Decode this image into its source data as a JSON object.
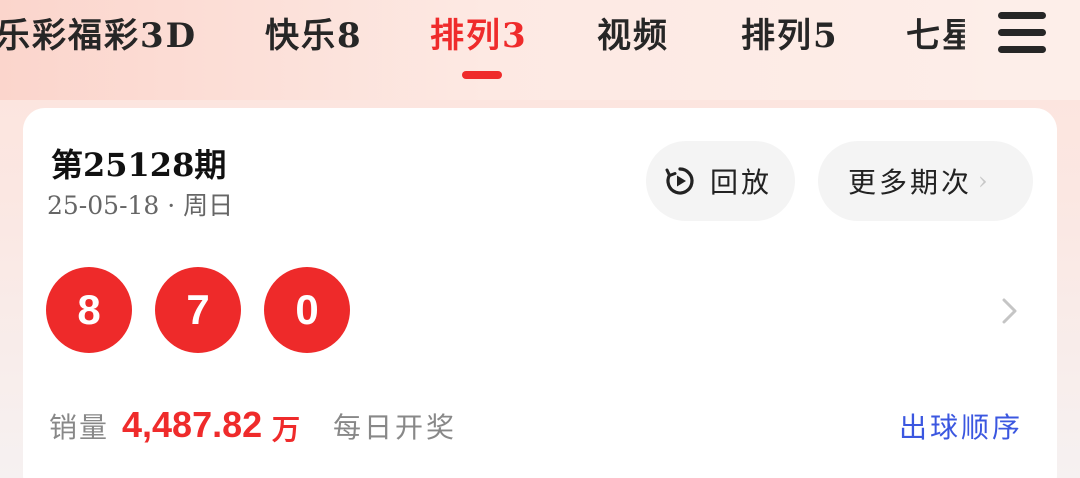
{
  "tabs": [
    {
      "label": "七乐彩",
      "active": false
    },
    {
      "label": "福彩3D",
      "active": false
    },
    {
      "label": "快乐8",
      "active": false
    },
    {
      "label": "排列3",
      "active": true
    },
    {
      "label": "视频",
      "active": false
    },
    {
      "label": "排列5",
      "active": false
    },
    {
      "label": "七星彩",
      "active": false
    }
  ],
  "menu_icon": "hamburger-menu-icon",
  "draw": {
    "issue": "第25128期",
    "date": "25-05-18 · 周日",
    "numbers": [
      "8",
      "7",
      "0"
    ],
    "ball_color": "#ee2a2a"
  },
  "actions": {
    "replay_label": "回放",
    "replay_icon": "replay-clock-icon",
    "more_label": "更多期次"
  },
  "footer": {
    "sales_label": "销量",
    "sales_value": "4,487.82",
    "sales_unit": "万",
    "schedule": "每日开奖",
    "order_link": "出球顺序"
  },
  "colors": {
    "accent": "#ef2b2b",
    "link": "#3b57e0"
  }
}
